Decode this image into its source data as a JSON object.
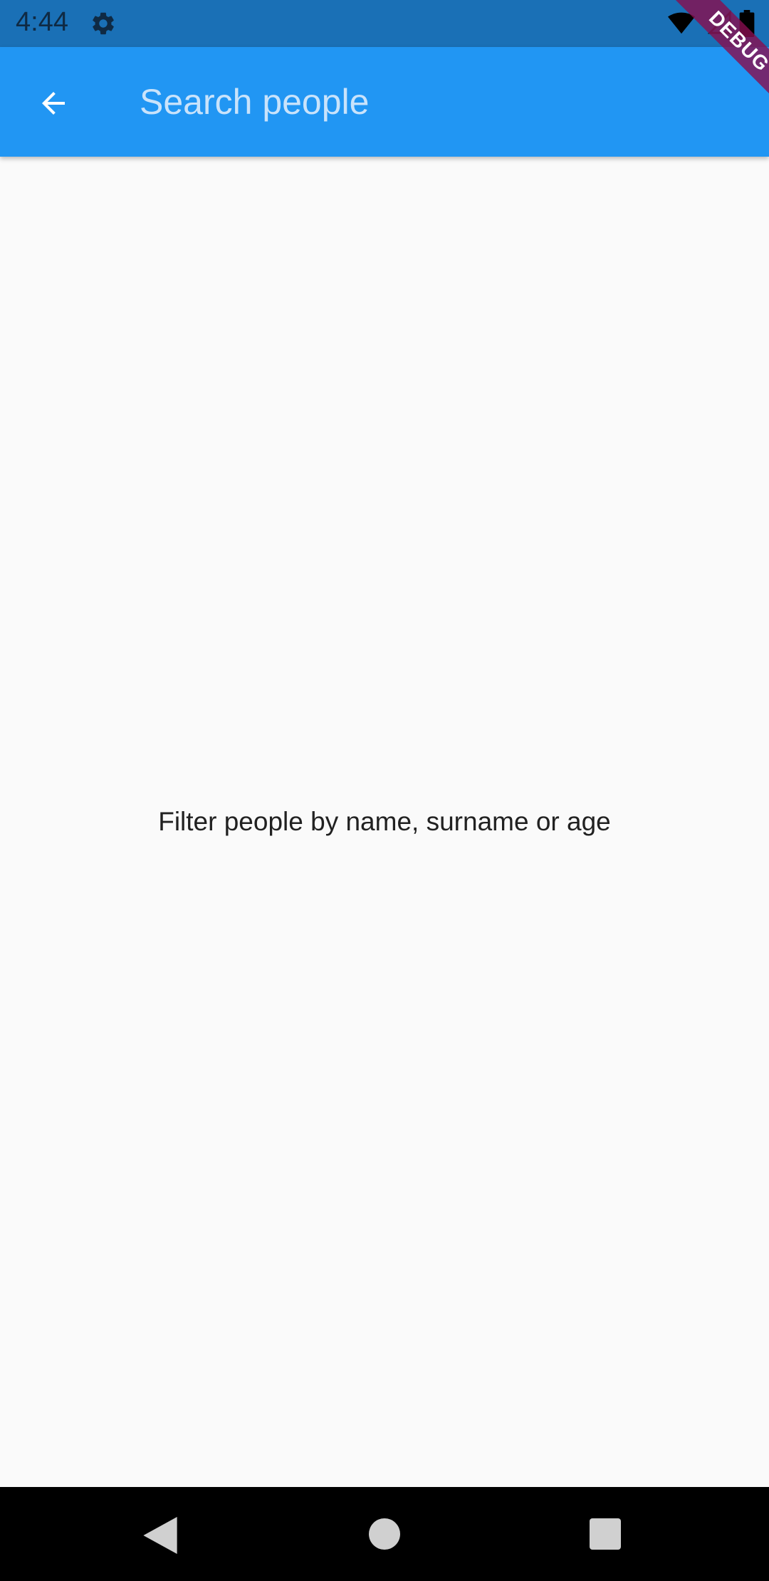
{
  "status_bar": {
    "time": "4:44",
    "icons": [
      "settings-gear-icon",
      "wifi-icon",
      "cell-signal-icon",
      "battery-icon"
    ]
  },
  "app_bar": {
    "back_icon": "arrow-back-icon",
    "search": {
      "placeholder": "Search people",
      "value": ""
    },
    "color": "#2196f3"
  },
  "debug_banner": {
    "label": "DEBUG",
    "color": "#880e4f"
  },
  "content": {
    "empty_message": "Filter people by name, surname or age"
  },
  "nav_bar": {
    "buttons": [
      "back-triangle-icon",
      "home-circle-icon",
      "recents-square-icon"
    ]
  }
}
